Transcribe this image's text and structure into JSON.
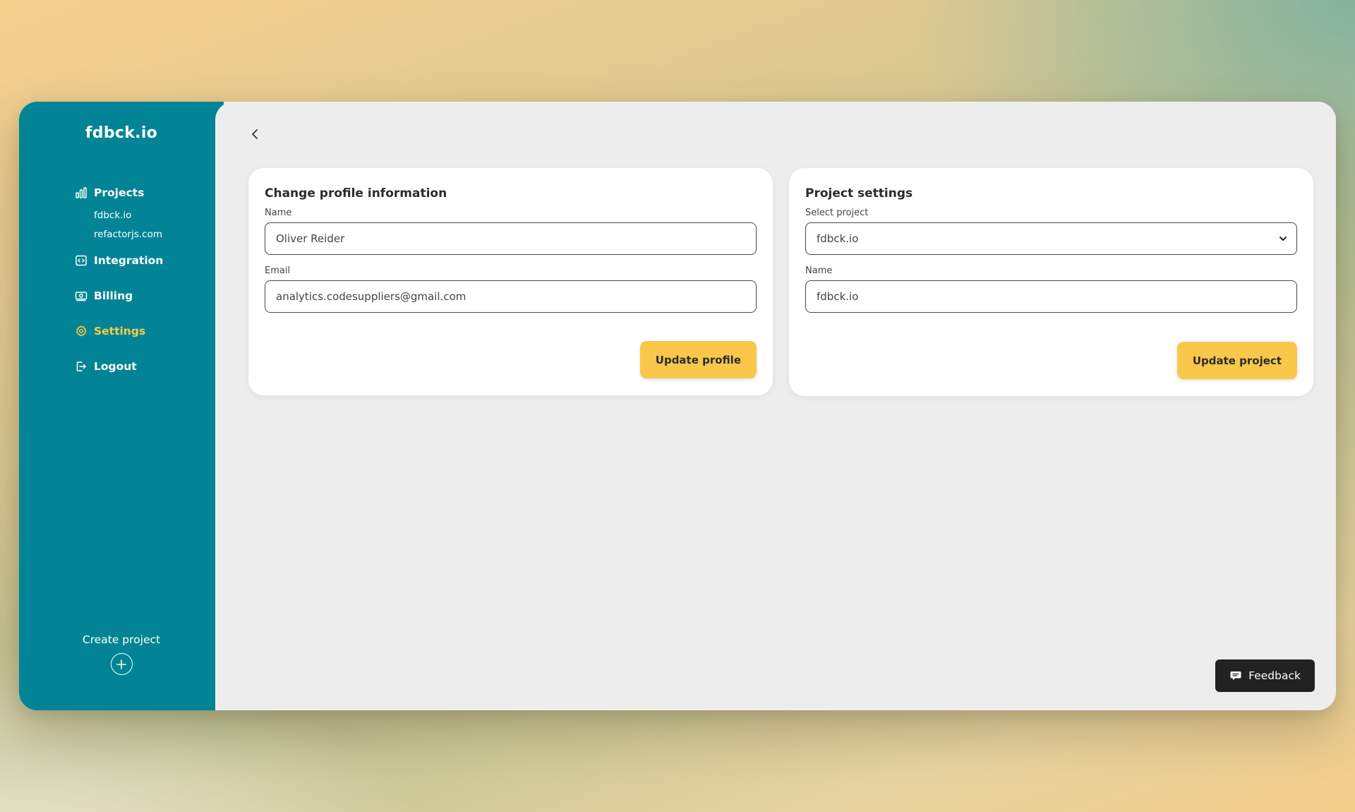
{
  "sidebar": {
    "brand": "fdbck.io",
    "nav": {
      "projects": "Projects",
      "project_items": [
        "fdbck.io",
        "refactorjs.com"
      ],
      "integration": "Integration",
      "billing": "Billing",
      "settings": "Settings",
      "logout": "Logout"
    },
    "active": "Settings",
    "create_label": "Create project"
  },
  "profile_card": {
    "title": "Change profile information",
    "name_label": "Name",
    "name_value": "Oliver Reider",
    "email_label": "Email",
    "email_value": "analytics.codesuppliers@gmail.com",
    "button": "Update profile"
  },
  "project_card": {
    "title": "Project settings",
    "select_label": "Select project",
    "select_value": "fdbck.io",
    "name_label": "Name",
    "name_value": "fdbck.io",
    "button": "Update project"
  },
  "feedback_label": "Feedback",
  "colors": {
    "sidebar": "#038496",
    "accent": "#f9c74a",
    "active_nav": "#f8cb4b",
    "feedback_bg": "#222222"
  }
}
